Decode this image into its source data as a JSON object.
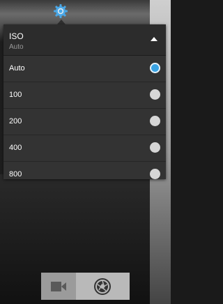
{
  "iso_menu": {
    "title": "ISO",
    "current_value": "Auto",
    "options": [
      {
        "label": "Auto",
        "selected": true
      },
      {
        "label": "100",
        "selected": false
      },
      {
        "label": "200",
        "selected": false
      },
      {
        "label": "400",
        "selected": false
      },
      {
        "label": "800",
        "selected": false
      }
    ]
  },
  "colors": {
    "accent": "#3aa3e3",
    "panel": "#333333",
    "text": "#ffffff",
    "subtext": "#9a9a9a"
  },
  "icons": {
    "top": "settings-gear-icon",
    "mode_video": "video-camera-icon",
    "mode_photo": "shutter-aperture-icon",
    "header_toggle": "collapse-triangle-icon"
  }
}
